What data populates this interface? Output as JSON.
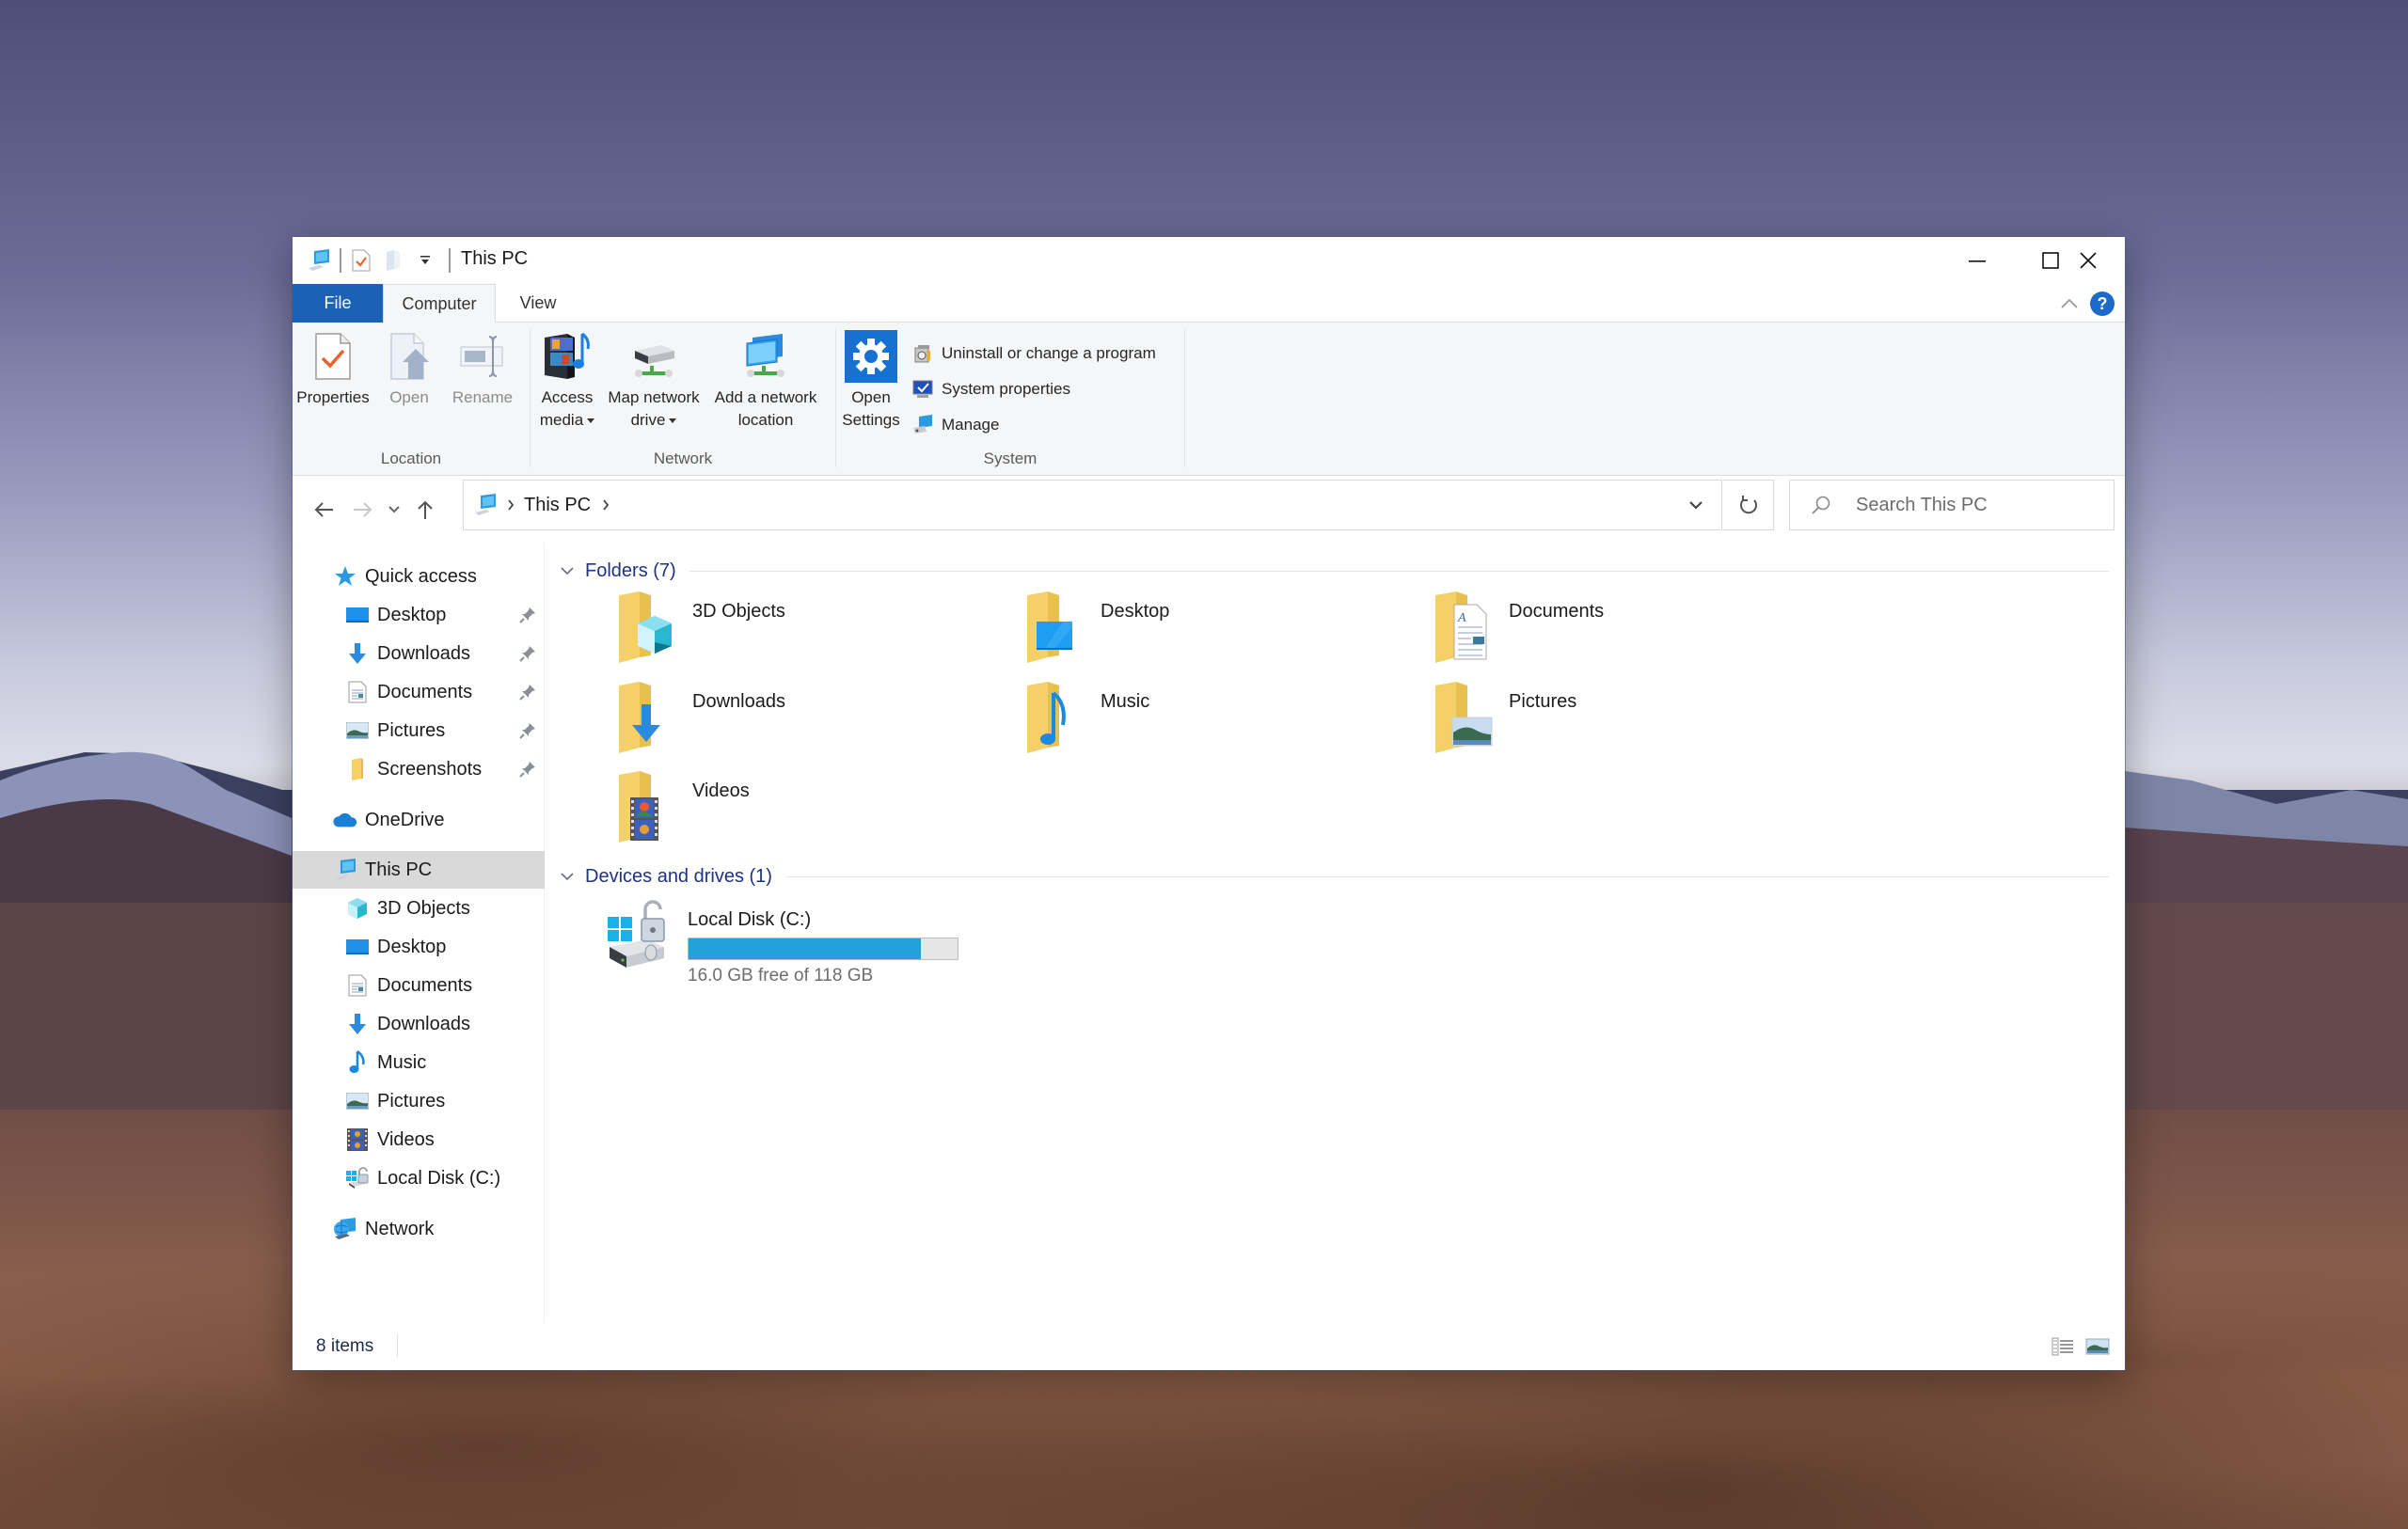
{
  "window": {
    "title": "This PC",
    "controls": {
      "minimize": "Minimize",
      "maximize": "Maximize",
      "close": "Close"
    }
  },
  "quick_access_toolbar": {
    "icons": [
      "this-pc-icon",
      "properties-icon",
      "new-folder-icon",
      "customize-dropdown-icon"
    ]
  },
  "ribbon": {
    "tabs": [
      {
        "label": "File",
        "state": "file-menu"
      },
      {
        "label": "Computer",
        "state": "active"
      },
      {
        "label": "View",
        "state": "normal"
      }
    ],
    "help_label": "?",
    "groups": [
      {
        "label": "Location",
        "buttons": [
          {
            "label": "Properties",
            "enabled": true
          },
          {
            "label": "Open",
            "enabled": false
          },
          {
            "label": "Rename",
            "enabled": false
          }
        ]
      },
      {
        "label": "Network",
        "buttons": [
          {
            "line1": "Access",
            "line2": "media",
            "dropdown": true
          },
          {
            "line1": "Map network",
            "line2": "drive",
            "dropdown": true
          },
          {
            "line1": "Add a network",
            "line2": "location",
            "dropdown": false
          }
        ]
      },
      {
        "label": "System",
        "big_button": {
          "line1": "Open",
          "line2": "Settings"
        },
        "small_buttons": [
          {
            "label": "Uninstall or change a program"
          },
          {
            "label": "System properties"
          },
          {
            "label": "Manage"
          }
        ]
      }
    ]
  },
  "address_bar": {
    "path": [
      "This PC"
    ],
    "search_placeholder": "Search This PC"
  },
  "nav_pane": {
    "quick_access": {
      "label": "Quick access",
      "items": [
        {
          "label": "Desktop",
          "icon": "desktop-icon",
          "pinned": true
        },
        {
          "label": "Downloads",
          "icon": "downloads-icon",
          "pinned": true
        },
        {
          "label": "Documents",
          "icon": "documents-icon",
          "pinned": true
        },
        {
          "label": "Pictures",
          "icon": "pictures-icon",
          "pinned": true
        },
        {
          "label": "Screenshots",
          "icon": "folder-icon",
          "pinned": true
        }
      ]
    },
    "onedrive": {
      "label": "OneDrive"
    },
    "this_pc": {
      "label": "This PC",
      "selected": true,
      "items": [
        {
          "label": "3D Objects",
          "icon": "3d-objects-icon"
        },
        {
          "label": "Desktop",
          "icon": "desktop-icon"
        },
        {
          "label": "Documents",
          "icon": "documents-icon"
        },
        {
          "label": "Downloads",
          "icon": "downloads-icon"
        },
        {
          "label": "Music",
          "icon": "music-icon"
        },
        {
          "label": "Pictures",
          "icon": "pictures-icon"
        },
        {
          "label": "Videos",
          "icon": "videos-icon"
        },
        {
          "label": "Local Disk (C:)",
          "icon": "local-disk-icon"
        }
      ]
    },
    "network": {
      "label": "Network"
    }
  },
  "content": {
    "folders_header": "Folders (7)",
    "folders": [
      {
        "name": "3D Objects",
        "overlay": "cube"
      },
      {
        "name": "Desktop",
        "overlay": "desktop"
      },
      {
        "name": "Documents",
        "overlay": "document"
      },
      {
        "name": "Downloads",
        "overlay": "arrow-down"
      },
      {
        "name": "Music",
        "overlay": "music-note"
      },
      {
        "name": "Pictures",
        "overlay": "picture"
      },
      {
        "name": "Videos",
        "overlay": "film"
      }
    ],
    "devices_header": "Devices and drives (1)",
    "drives": [
      {
        "name": "Local Disk (C:)",
        "free_text": "16.0 GB free of 118 GB",
        "free_gb": 16.0,
        "total_gb": 118,
        "used_fraction": 0.864
      }
    ]
  },
  "status_bar": {
    "items_count": "8 items",
    "views": [
      "details-view",
      "large-icons-view"
    ]
  },
  "colors": {
    "accent": "#1b62b5",
    "section_header": "#1e3287",
    "drive_bar_fill": "#26a0da",
    "selection": "#d9d9d9"
  }
}
